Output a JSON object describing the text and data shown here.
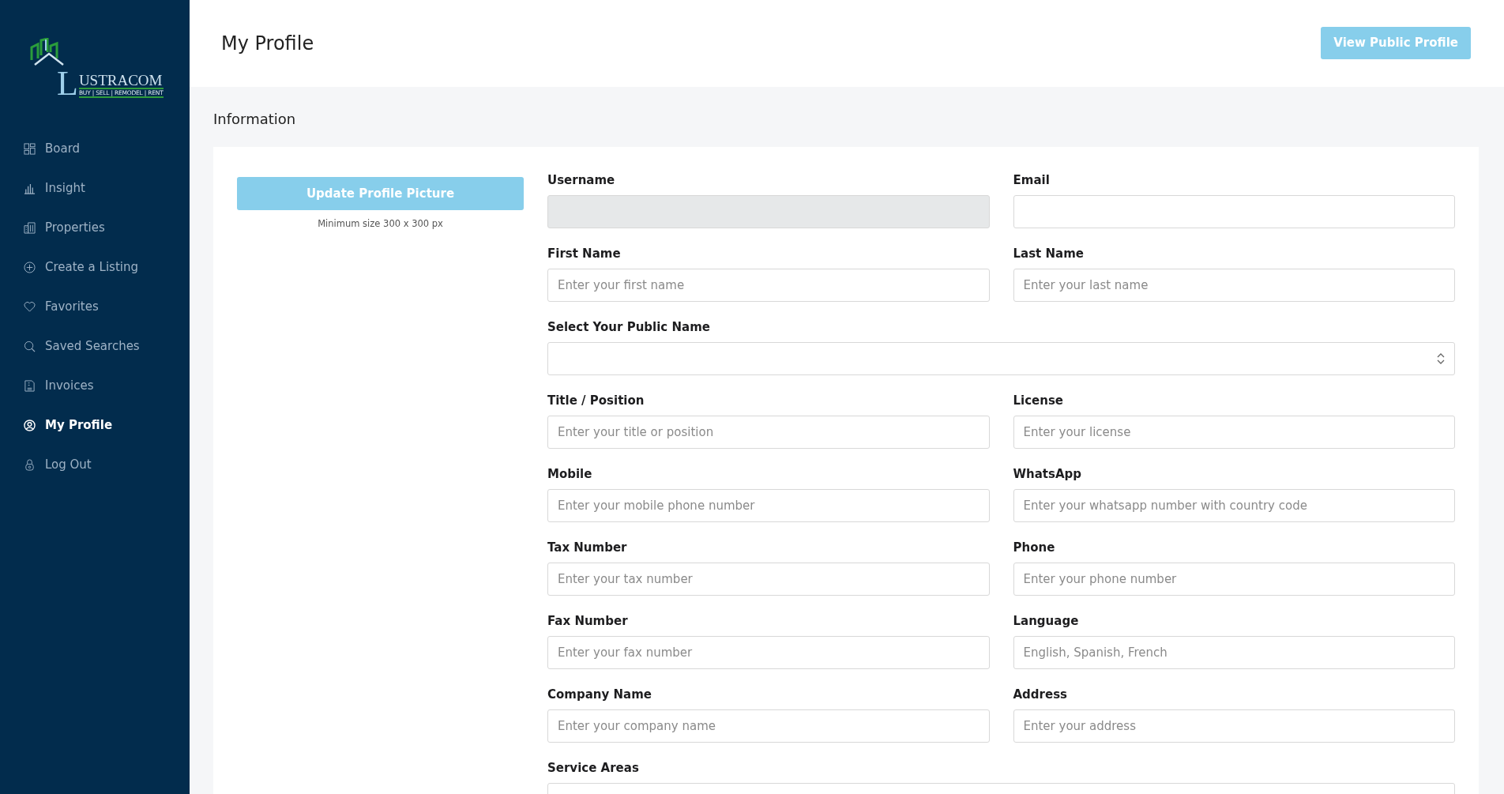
{
  "logo": {
    "initial": "L",
    "name": "USTRACOM",
    "tagline": "BUY | SELL | REMODEL | RENT"
  },
  "sidebar": {
    "items": [
      {
        "label": "Board",
        "selected": false
      },
      {
        "label": "Insight",
        "selected": false
      },
      {
        "label": "Properties",
        "selected": false
      },
      {
        "label": "Create a Listing",
        "selected": false
      },
      {
        "label": "Favorites",
        "selected": false
      },
      {
        "label": "Saved Searches",
        "selected": false
      },
      {
        "label": "Invoices",
        "selected": false
      },
      {
        "label": "My Profile",
        "selected": true
      },
      {
        "label": "Log Out",
        "selected": false
      }
    ]
  },
  "header": {
    "title": "My Profile",
    "button": "View Public Profile"
  },
  "section_title": "Information",
  "picture": {
    "button": "Update Profile Picture",
    "hint": "Minimum size 300 x 300 px"
  },
  "fields": [
    {
      "label": "Username",
      "kind": "text",
      "full_width": false,
      "disabled": true
    },
    {
      "label": "Email",
      "kind": "text",
      "full_width": false,
      "disabled": false
    },
    {
      "label": "First Name",
      "kind": "text",
      "full_width": false,
      "disabled": false,
      "placeholder": "Enter your first name"
    },
    {
      "label": "Last Name",
      "kind": "text",
      "full_width": false,
      "disabled": false,
      "placeholder": "Enter your last name"
    },
    {
      "label": "Select Your Public Name",
      "kind": "select",
      "full_width": true,
      "disabled": false
    },
    {
      "label": "Title / Position",
      "kind": "text",
      "full_width": false,
      "disabled": false,
      "placeholder": "Enter your title or position"
    },
    {
      "label": "License",
      "kind": "text",
      "full_width": false,
      "disabled": false,
      "placeholder": "Enter your license"
    },
    {
      "label": "Mobile",
      "kind": "text",
      "full_width": false,
      "disabled": false,
      "placeholder": "Enter your mobile phone number"
    },
    {
      "label": "WhatsApp",
      "kind": "text",
      "full_width": false,
      "disabled": false,
      "placeholder": "Enter your whatsapp number with country code"
    },
    {
      "label": "Tax Number",
      "kind": "text",
      "full_width": false,
      "disabled": false,
      "placeholder": "Enter your tax number"
    },
    {
      "label": "Phone",
      "kind": "text",
      "full_width": false,
      "disabled": false,
      "placeholder": "Enter your phone number"
    },
    {
      "label": "Fax Number",
      "kind": "text",
      "full_width": false,
      "disabled": false,
      "placeholder": "Enter your fax number"
    },
    {
      "label": "Language",
      "kind": "text",
      "full_width": false,
      "disabled": false,
      "placeholder": "English, Spanish, French"
    },
    {
      "label": "Company Name",
      "kind": "text",
      "full_width": false,
      "disabled": false,
      "placeholder": "Enter your company name"
    },
    {
      "label": "Address",
      "kind": "text",
      "full_width": false,
      "disabled": false,
      "placeholder": "Enter your address"
    },
    {
      "label": "Service Areas",
      "kind": "text",
      "full_width": true,
      "disabled": false
    }
  ]
}
